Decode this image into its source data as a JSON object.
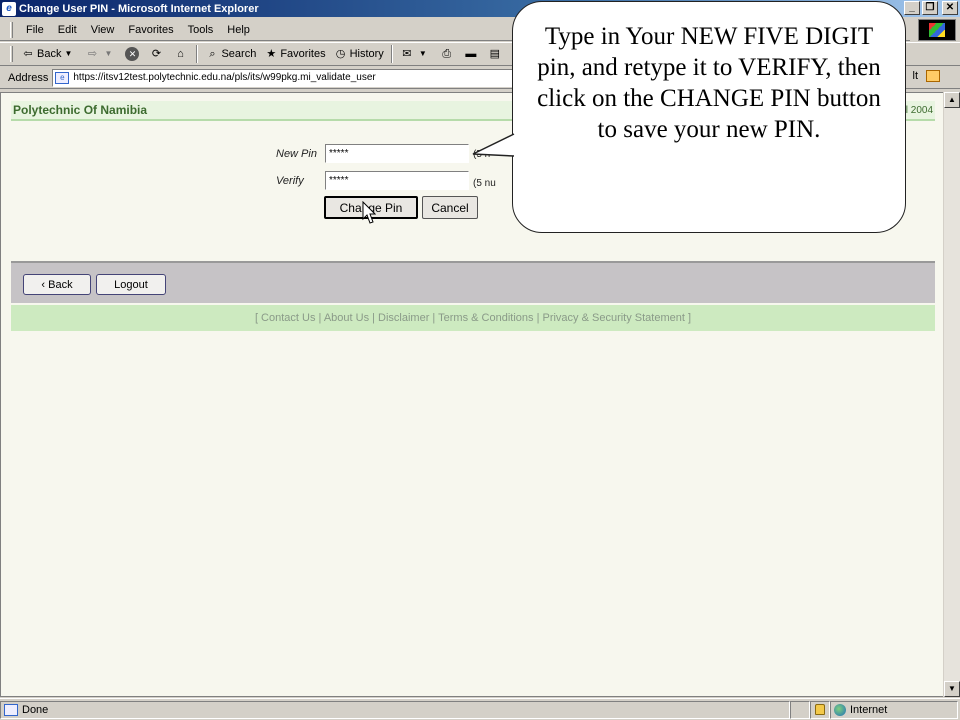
{
  "window": {
    "title": "Change User PIN - Microsoft Internet Explorer",
    "minimize": "_",
    "restore": "❐",
    "close": "✕"
  },
  "menu": [
    "File",
    "Edit",
    "View",
    "Favorites",
    "Tools",
    "Help"
  ],
  "toolbar": {
    "back": "Back",
    "search": "Search",
    "favorites": "Favorites",
    "history": "History"
  },
  "address": {
    "label": "Address",
    "url": "https://itsv12test.polytechnic.edu.na/pls/its/w99pkg.mi_validate_user",
    "links_tail": "lt"
  },
  "site": {
    "title": "Polytechnic Of Namibia",
    "date_fragment": "il 2004"
  },
  "form": {
    "new_pin_label": "New Pin",
    "new_pin_value": "*****",
    "new_pin_hint": "(5 n",
    "verify_label": "Verify",
    "verify_value": "*****",
    "verify_hint": "(5 nu",
    "change_pin_button": "Change Pin",
    "cancel_button": "Cancel"
  },
  "nav": {
    "back_button": "‹ Back",
    "logout_button": "Logout"
  },
  "footer": {
    "links_text": "[ Contact Us | About Us | Disclaimer | Terms & Conditions | Privacy & Security Statement ]"
  },
  "callout": {
    "text": "Type in Your NEW FIVE DIGIT pin, and retype it to VERIFY, then click on the CHANGE PIN button to save your new PIN."
  },
  "status": {
    "text": "Done",
    "zone": "Internet"
  }
}
